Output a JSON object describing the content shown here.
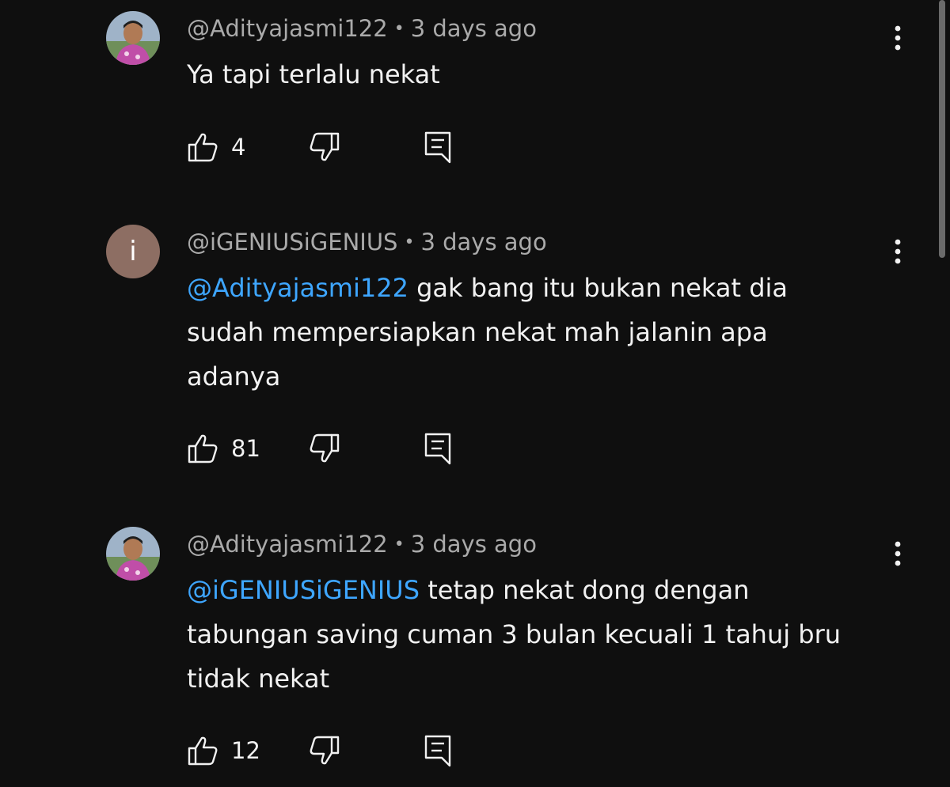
{
  "comments": [
    {
      "author": "@Adityajasmi122",
      "time": "3 days ago",
      "mention": "",
      "text": "Ya tapi terlalu nekat",
      "likes": "4",
      "avatar": "photo",
      "avatar_letter": ""
    },
    {
      "author": "@iGENIUSiGENIUS",
      "time": "3 days ago",
      "mention": "@Adityajasmi122",
      "text": " gak bang itu bukan nekat dia sudah mempersiapkan nekat mah jalanin apa adanya",
      "likes": "81",
      "avatar": "letter",
      "avatar_letter": "i"
    },
    {
      "author": "@Adityajasmi122",
      "time": "3 days ago",
      "mention": "@iGENIUSiGENIUS",
      "text": " tetap nekat dong dengan tabungan saving cuman 3 bulan kecuali 1 tahuj bru tidak nekat",
      "likes": "12",
      "avatar": "photo",
      "avatar_letter": ""
    }
  ],
  "separator": "•",
  "icons": {
    "like": "thumbs-up-icon",
    "dislike": "thumbs-down-icon",
    "reply": "reply-icon",
    "more": "more-vertical-icon"
  },
  "colors": {
    "background": "#0f0f0f",
    "text": "#f1f1f1",
    "meta": "#aaaaaa",
    "mention": "#3ea6ff",
    "letter_avatar": "#8d6e63"
  }
}
